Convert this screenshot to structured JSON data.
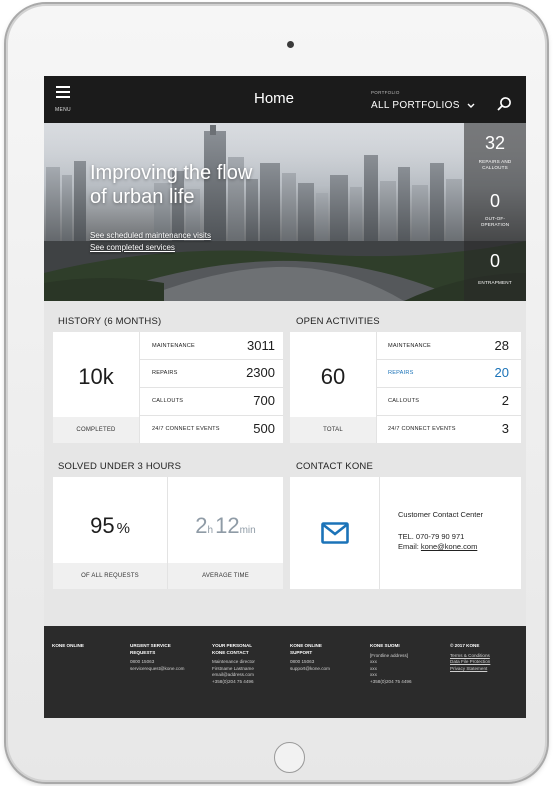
{
  "topbar": {
    "menu_label": "MENU",
    "title": "Home",
    "portfolio_small": "PORTFOLIO",
    "portfolio_value": "ALL PORTFOLIOS"
  },
  "hero": {
    "title_line1": "Improving the flow",
    "title_line2": "of urban life",
    "link1": "See scheduled maintenance visits",
    "link2": "See completed services",
    "stats": [
      {
        "value": "32",
        "label_line1": "REPAIRS AND",
        "label_line2": "CALLOUTS"
      },
      {
        "value": "0",
        "label_line1": "OUT-OF-",
        "label_line2": "OPERATION"
      },
      {
        "value": "0",
        "label_line1": "ENTRAPMENT",
        "label_line2": ""
      }
    ]
  },
  "history": {
    "title": "HISTORY (6 MONTHS)",
    "big_value": "10k",
    "big_label": "COMPLETED",
    "rows": [
      {
        "label": "MAINTENANCE",
        "value": "3011"
      },
      {
        "label": "REPAIRS",
        "value": "2300"
      },
      {
        "label": "CALLOUTS",
        "value": "700"
      },
      {
        "label": "24/7 CONNECT EVENTS",
        "value": "500"
      }
    ]
  },
  "open_activities": {
    "title": "OPEN ACTIVITIES",
    "big_value": "60",
    "big_label": "TOTAL",
    "rows": [
      {
        "label": "MAINTENANCE",
        "value": "28"
      },
      {
        "label": "REPAIRS",
        "value": "20"
      },
      {
        "label": "CALLOUTS",
        "value": "2"
      },
      {
        "label": "24/7 CONNECT EVENTS",
        "value": "3"
      }
    ],
    "highlight_color": "#1b73b8"
  },
  "solved": {
    "title": "SOLVED UNDER 3 HOURS",
    "percent_value": "95",
    "percent_unit": "%",
    "percent_label": "OF ALL REQUESTS",
    "hours": "2",
    "hours_unit": "h",
    "minutes": "12",
    "minutes_unit": "min",
    "time_label": "AVERAGE TIME"
  },
  "contact": {
    "title": "CONTACT KONE",
    "heading": "Customer Contact Center",
    "tel": "TEL. 070-79 90 971",
    "email_prefix": "Email: ",
    "email": "kone@kone.com",
    "icon_color": "#1b73b8"
  },
  "footer": {
    "col1": {
      "heading": "KONE ONLINE"
    },
    "col2": {
      "heading_line1": "URGENT SERVICE",
      "heading_line2": "REQUESTS",
      "line1": "0800 15063",
      "line2": "servicerequest@kone.com"
    },
    "col3": {
      "heading_line1": "YOUR PERSONAL",
      "heading_line2": "KONE CONTACT",
      "line1": "Maintenance director",
      "line2": "Firstname Lastname",
      "line3": "email@address.com",
      "line4": "+358(0)204 75 4496"
    },
    "col4": {
      "heading_line1": "KONE ONLINE",
      "heading_line2": "SUPPORT",
      "line1": "0800 15063",
      "line2": "support@kone.com"
    },
    "col5": {
      "heading": "KONE SUOMI",
      "line1": "[Frontline address]",
      "line2": "xxx",
      "line3": "xxx",
      "line4": "xxx",
      "line5": "+358(0)204 75 4496"
    },
    "col6": {
      "heading": "© 2017 KONE",
      "link1": "Terms & Conditions",
      "link2": "Data File Protection",
      "link3": "Privacy Statement"
    }
  }
}
